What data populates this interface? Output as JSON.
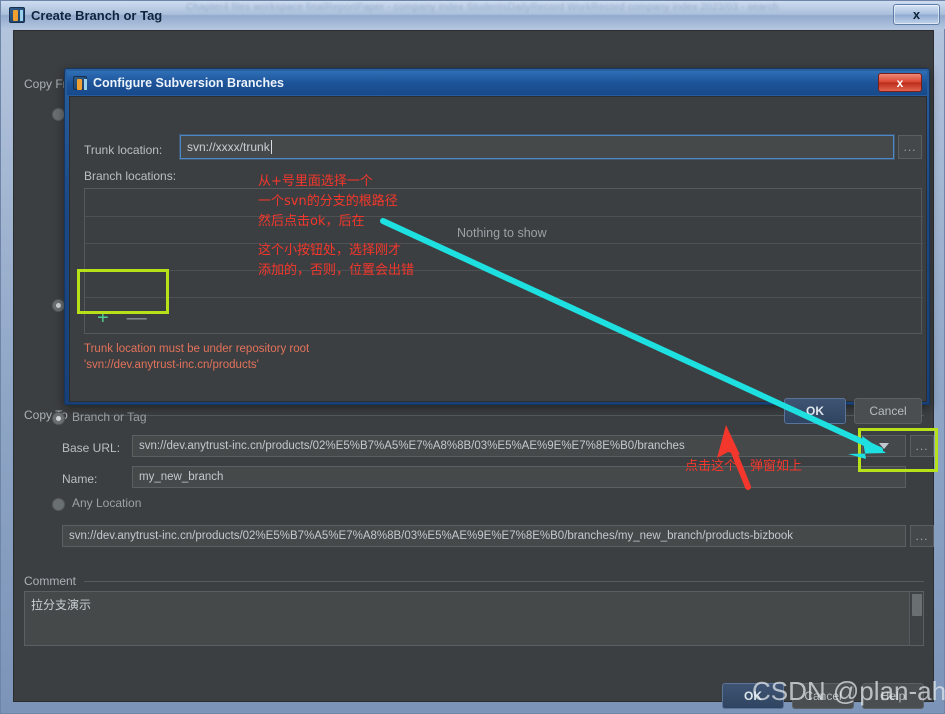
{
  "main_window": {
    "title": "Create Branch or Tag",
    "icon": "intellij-app-icon",
    "close_label": "x",
    "ghost_titlebar_text": "Chapter4 files workspace finalReportPaper - company index StudentsDailyRecord WorkRecord company index 2023/03 - search"
  },
  "copy_from": {
    "group_label": "Copy From",
    "options": [
      {
        "label": "",
        "selected": false
      },
      {
        "label": "",
        "selected": true
      }
    ]
  },
  "copy_to": {
    "group_label": "Copy To",
    "branch_or_tag": {
      "radio_label": "Branch or Tag",
      "selected": true,
      "base_url_label": "Base URL:",
      "base_url_value": "svn://dev.anytrust-inc.cn/products/02%E5%B7%A5%E7%A8%8B/03%E5%AE%9E%E7%8E%B0/branches",
      "name_label": "Name:",
      "name_value": "my_new_branch",
      "dropdown_icon": "chevron-down-icon",
      "browse_label": "..."
    },
    "any_location": {
      "radio_label": "Any Location",
      "selected": false,
      "value": "svn://dev.anytrust-inc.cn/products/02%E5%B7%A5%E7%A8%8B/03%E5%AE%9E%E7%8E%B0/branches/my_new_branch/products-bizbook",
      "browse_label": "..."
    }
  },
  "comment": {
    "group_label": "Comment",
    "value": "拉分支演示"
  },
  "footer": {
    "ok_label": "OK",
    "cancel_label": "Cancel",
    "help_label": "Help"
  },
  "config_dialog": {
    "title": "Configure Subversion Branches",
    "icon": "intellij-app-icon",
    "close_label": "x",
    "trunk_label": "Trunk location:",
    "trunk_value": "svn://xxxx/trunk",
    "trunk_browse_label": "...",
    "branch_locations_label": "Branch locations:",
    "empty_text": "Nothing to show",
    "add_label": "+",
    "remove_label": "—",
    "error_line1": "Trunk location must be under repository root",
    "error_line2": "'svn://dev.anytrust-inc.cn/products'",
    "ok_label": "OK",
    "cancel_label": "Cancel"
  },
  "annotations": {
    "note1_line1": "从+号里面选择一个",
    "note1_line2": "一个svn的分支的根路径",
    "note1_line3": "然后点击ok，后在",
    "note2_line1": "这个小按钮处，选择刚才",
    "note2_line2": "添加的，否则，位置会出错",
    "note3": "点击这个，弹窗如上",
    "highlight_color": "#b7e118",
    "arrow_color_cyan": "#1ee0e0",
    "arrow_color_red": "#f4372c",
    "text_color": "#f4372c"
  },
  "watermark": {
    "text": "CSDN @plan-ahead"
  }
}
